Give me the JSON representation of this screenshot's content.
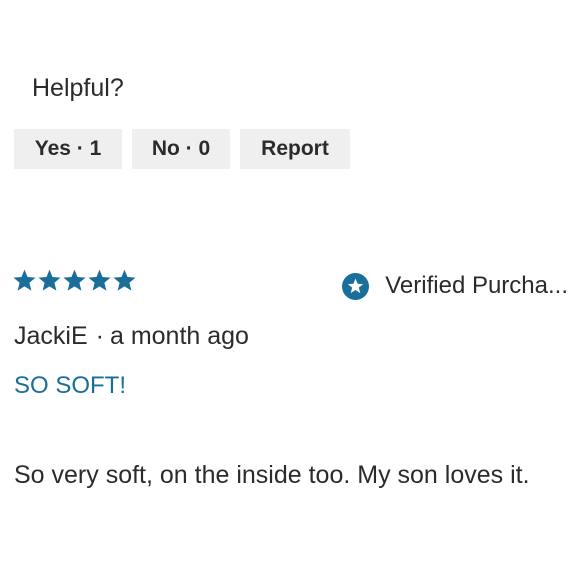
{
  "helpful": {
    "label": "Helpful?",
    "yes_label": "Yes · 1",
    "no_label": "No · 0",
    "report_label": "Report"
  },
  "review": {
    "rating": 5,
    "rating_max": 5,
    "star_color": "#1a6e9a",
    "star_icon": "star-icon",
    "verified_icon": "verified-star-badge-icon",
    "verified_text": "Verified Purcha...",
    "author": "JackiE",
    "separator": "·",
    "time_ago": "a month ago",
    "title": "SO SOFT!",
    "body": "So very soft, on the inside too. My son loves it."
  },
  "colors": {
    "accent": "#1a6e9a",
    "button_bg": "#efefef",
    "text": "#2b2b2b"
  }
}
